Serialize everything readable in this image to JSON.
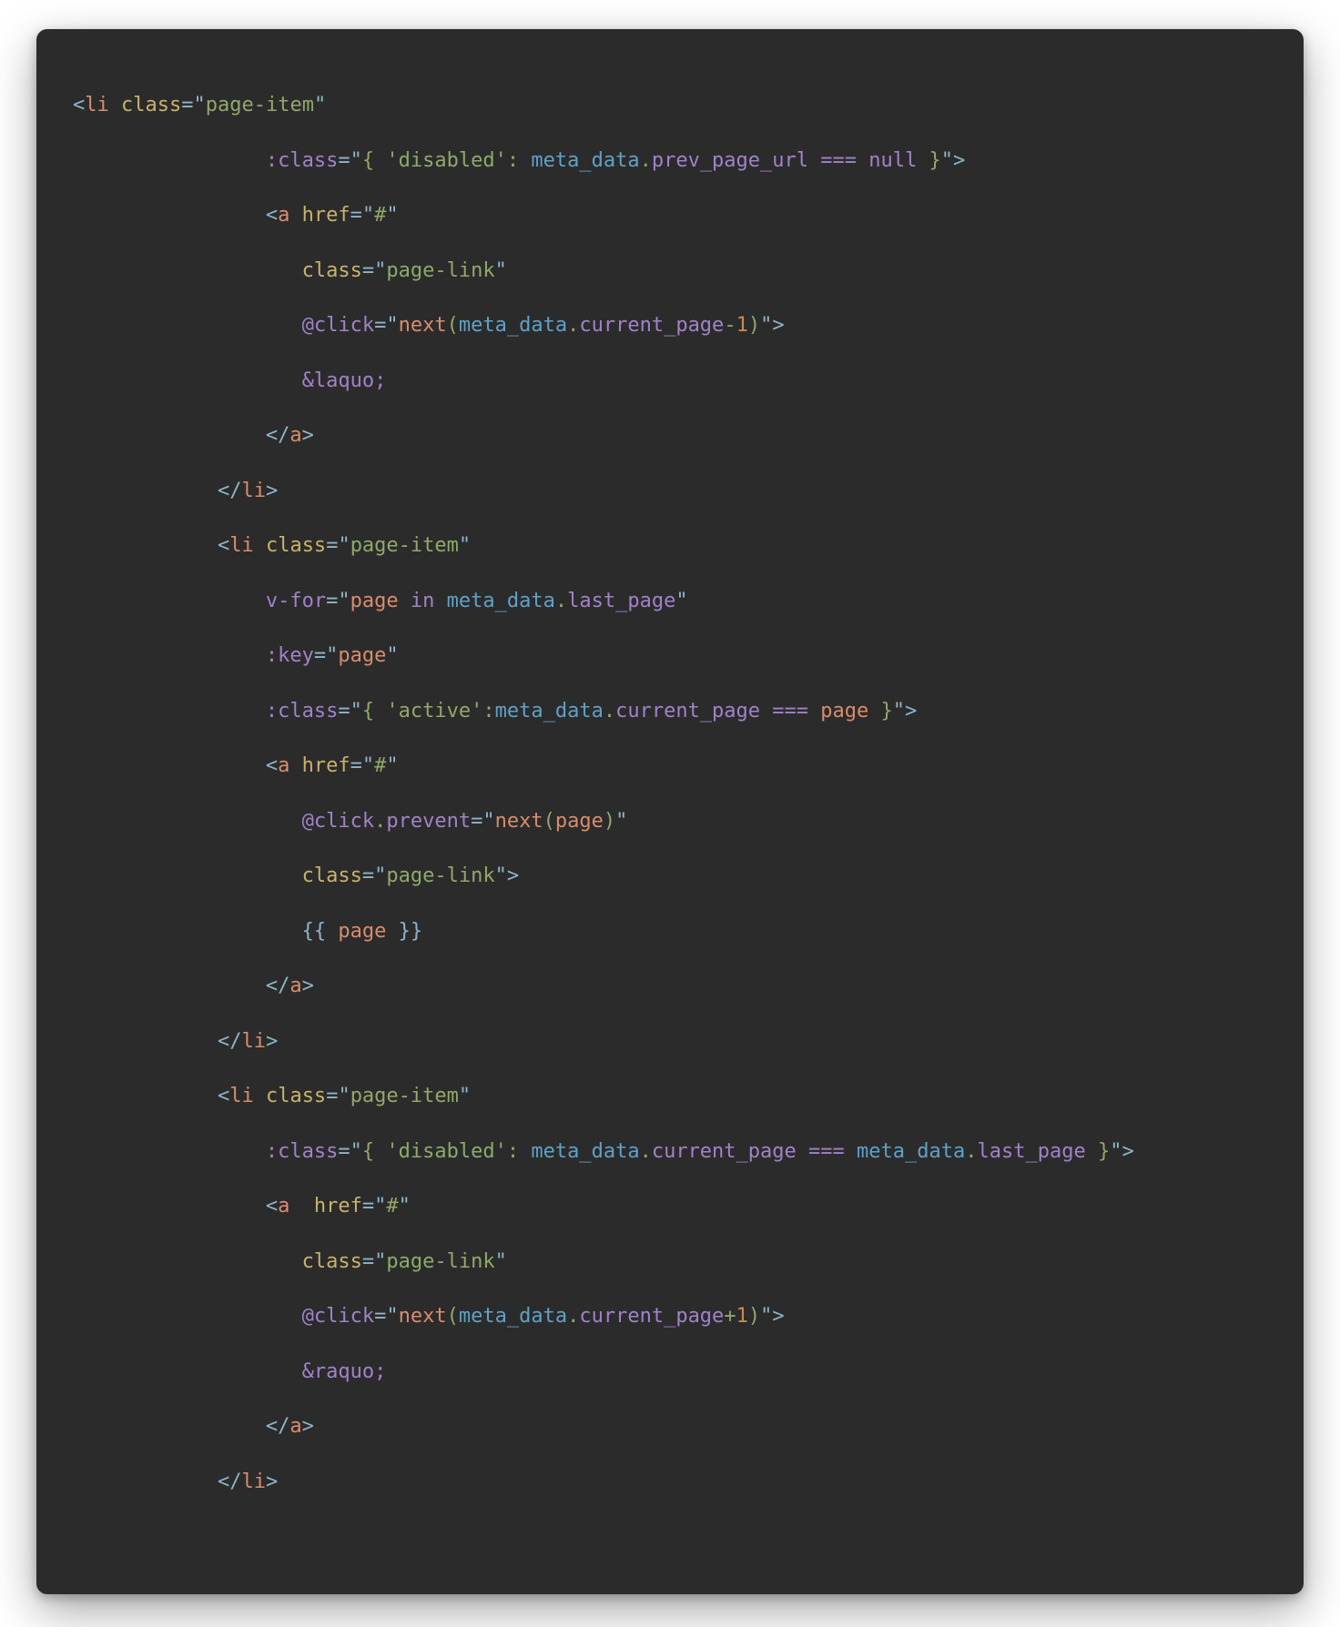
{
  "code": {
    "language": "vue-html",
    "raw": "<li class=\"page-item\"\n                :class=\"{ 'disabled': meta_data.prev_page_url === null }\">\n                <a href=\"#\"\n                   class=\"page-link\"\n                   @click=\"next(meta_data.current_page-1)\">\n                   &laquo;\n                </a>\n            </li>\n            <li class=\"page-item\"\n                v-for=\"page in meta_data.last_page\"\n                :key=\"page\"\n                :class=\"{ 'active':meta_data.current_page === page }\">\n                <a href=\"#\"\n                   @click.prevent=\"next(page)\"\n                   class=\"page-link\">\n                   {{ page }}\n                </a>\n            </li>\n            <li class=\"page-item\"\n                :class=\"{ 'disabled': meta_data.current_page === meta_data.last_page }\">\n                <a  href=\"#\"\n                   class=\"page-link\"\n                   @click=\"next(meta_data.current_page+1)\">\n                   &raquo;\n                </a>\n            </li>",
    "tokens": [
      [
        [
          "pun",
          "<"
        ],
        [
          "tag",
          "li"
        ],
        [
          "",
          " "
        ],
        [
          "attr",
          "class"
        ],
        [
          "pun",
          "="
        ],
        [
          "pun",
          "\""
        ],
        [
          "str",
          "page-item"
        ],
        [
          "pun",
          "\""
        ]
      ],
      [
        [
          "",
          "                "
        ],
        [
          "dir",
          ":class"
        ],
        [
          "pun",
          "="
        ],
        [
          "pun",
          "\""
        ],
        [
          "str",
          "{ "
        ],
        [
          "str",
          "'disabled'"
        ],
        [
          "str",
          ": "
        ],
        [
          "obj",
          "meta_data"
        ],
        [
          "str",
          "."
        ],
        [
          "prop",
          "prev_page_url"
        ],
        [
          "",
          " "
        ],
        [
          "kw",
          "==="
        ],
        [
          "",
          " "
        ],
        [
          "kw",
          "null"
        ],
        [
          "str",
          " }"
        ],
        [
          "pun",
          "\""
        ],
        [
          "pun",
          ">"
        ]
      ],
      [
        [
          "",
          "                "
        ],
        [
          "pun",
          "<"
        ],
        [
          "tag",
          "a"
        ],
        [
          "",
          " "
        ],
        [
          "attr",
          "href"
        ],
        [
          "pun",
          "="
        ],
        [
          "pun",
          "\""
        ],
        [
          "str",
          "#"
        ],
        [
          "pun",
          "\""
        ]
      ],
      [
        [
          "",
          "                   "
        ],
        [
          "attr",
          "class"
        ],
        [
          "pun",
          "="
        ],
        [
          "pun",
          "\""
        ],
        [
          "str",
          "page-link"
        ],
        [
          "pun",
          "\""
        ]
      ],
      [
        [
          "",
          "                   "
        ],
        [
          "dir",
          "@click"
        ],
        [
          "pun",
          "="
        ],
        [
          "pun",
          "\""
        ],
        [
          "fn",
          "next"
        ],
        [
          "str",
          "("
        ],
        [
          "obj",
          "meta_data"
        ],
        [
          "str",
          "."
        ],
        [
          "prop",
          "current_page"
        ],
        [
          "str",
          "-"
        ],
        [
          "num",
          "1"
        ],
        [
          "str",
          ")"
        ],
        [
          "pun",
          "\""
        ],
        [
          "pun",
          ">"
        ]
      ],
      [
        [
          "",
          "                   "
        ],
        [
          "ent",
          "&laquo;"
        ]
      ],
      [
        [
          "",
          "                "
        ],
        [
          "pun",
          "</"
        ],
        [
          "tag",
          "a"
        ],
        [
          "pun",
          ">"
        ]
      ],
      [
        [
          "",
          "            "
        ],
        [
          "pun",
          "</"
        ],
        [
          "tag",
          "li"
        ],
        [
          "pun",
          ">"
        ]
      ],
      [
        [
          "",
          "            "
        ],
        [
          "pun",
          "<"
        ],
        [
          "tag",
          "li"
        ],
        [
          "",
          " "
        ],
        [
          "attr",
          "class"
        ],
        [
          "pun",
          "="
        ],
        [
          "pun",
          "\""
        ],
        [
          "str",
          "page-item"
        ],
        [
          "pun",
          "\""
        ]
      ],
      [
        [
          "",
          "                "
        ],
        [
          "dir",
          "v-for"
        ],
        [
          "pun",
          "="
        ],
        [
          "pun",
          "\""
        ],
        [
          "var",
          "page"
        ],
        [
          "",
          " "
        ],
        [
          "kw",
          "in"
        ],
        [
          "",
          " "
        ],
        [
          "obj",
          "meta_data"
        ],
        [
          "str",
          "."
        ],
        [
          "prop",
          "last_page"
        ],
        [
          "pun",
          "\""
        ]
      ],
      [
        [
          "",
          "                "
        ],
        [
          "dir",
          ":key"
        ],
        [
          "pun",
          "="
        ],
        [
          "pun",
          "\""
        ],
        [
          "var",
          "page"
        ],
        [
          "pun",
          "\""
        ]
      ],
      [
        [
          "",
          "                "
        ],
        [
          "dir",
          ":class"
        ],
        [
          "pun",
          "="
        ],
        [
          "pun",
          "\""
        ],
        [
          "str",
          "{ "
        ],
        [
          "str",
          "'active'"
        ],
        [
          "str",
          ":"
        ],
        [
          "obj",
          "meta_data"
        ],
        [
          "str",
          "."
        ],
        [
          "prop",
          "current_page"
        ],
        [
          "",
          " "
        ],
        [
          "kw",
          "==="
        ],
        [
          "",
          " "
        ],
        [
          "var",
          "page"
        ],
        [
          "str",
          " }"
        ],
        [
          "pun",
          "\""
        ],
        [
          "pun",
          ">"
        ]
      ],
      [
        [
          "",
          "                "
        ],
        [
          "pun",
          "<"
        ],
        [
          "tag",
          "a"
        ],
        [
          "",
          " "
        ],
        [
          "attr",
          "href"
        ],
        [
          "pun",
          "="
        ],
        [
          "pun",
          "\""
        ],
        [
          "str",
          "#"
        ],
        [
          "pun",
          "\""
        ]
      ],
      [
        [
          "",
          "                   "
        ],
        [
          "dir",
          "@click"
        ],
        [
          "str",
          "."
        ],
        [
          "prop",
          "prevent"
        ],
        [
          "pun",
          "="
        ],
        [
          "pun",
          "\""
        ],
        [
          "fn",
          "next"
        ],
        [
          "str",
          "("
        ],
        [
          "var",
          "page"
        ],
        [
          "str",
          ")"
        ],
        [
          "pun",
          "\""
        ]
      ],
      [
        [
          "",
          "                   "
        ],
        [
          "attr",
          "class"
        ],
        [
          "pun",
          "="
        ],
        [
          "pun",
          "\""
        ],
        [
          "str",
          "page-link"
        ],
        [
          "pun",
          "\""
        ],
        [
          "pun",
          ">"
        ]
      ],
      [
        [
          "",
          "                   "
        ],
        [
          "expr",
          "{{ "
        ],
        [
          "var",
          "page"
        ],
        [
          "expr",
          " }}"
        ]
      ],
      [
        [
          "",
          "                "
        ],
        [
          "pun",
          "</"
        ],
        [
          "tag",
          "a"
        ],
        [
          "pun",
          ">"
        ]
      ],
      [
        [
          "",
          "            "
        ],
        [
          "pun",
          "</"
        ],
        [
          "tag",
          "li"
        ],
        [
          "pun",
          ">"
        ]
      ],
      [
        [
          "",
          "            "
        ],
        [
          "pun",
          "<"
        ],
        [
          "tag",
          "li"
        ],
        [
          "",
          " "
        ],
        [
          "attr",
          "class"
        ],
        [
          "pun",
          "="
        ],
        [
          "pun",
          "\""
        ],
        [
          "str",
          "page-item"
        ],
        [
          "pun",
          "\""
        ]
      ],
      [
        [
          "",
          "                "
        ],
        [
          "dir",
          ":class"
        ],
        [
          "pun",
          "="
        ],
        [
          "pun",
          "\""
        ],
        [
          "str",
          "{ "
        ],
        [
          "str",
          "'disabled'"
        ],
        [
          "str",
          ": "
        ],
        [
          "obj",
          "meta_data"
        ],
        [
          "str",
          "."
        ],
        [
          "prop",
          "current_page"
        ],
        [
          "",
          " "
        ],
        [
          "kw",
          "==="
        ],
        [
          "",
          " "
        ],
        [
          "obj",
          "meta_data"
        ],
        [
          "str",
          "."
        ],
        [
          "prop",
          "last_page"
        ],
        [
          "str",
          " }"
        ],
        [
          "pun",
          "\""
        ],
        [
          "pun",
          ">"
        ]
      ],
      [
        [
          "",
          "                "
        ],
        [
          "pun",
          "<"
        ],
        [
          "tag",
          "a"
        ],
        [
          "",
          "  "
        ],
        [
          "attr",
          "href"
        ],
        [
          "pun",
          "="
        ],
        [
          "pun",
          "\""
        ],
        [
          "str",
          "#"
        ],
        [
          "pun",
          "\""
        ]
      ],
      [
        [
          "",
          "                   "
        ],
        [
          "attr",
          "class"
        ],
        [
          "pun",
          "="
        ],
        [
          "pun",
          "\""
        ],
        [
          "str",
          "page-link"
        ],
        [
          "pun",
          "\""
        ]
      ],
      [
        [
          "",
          "                   "
        ],
        [
          "dir",
          "@click"
        ],
        [
          "pun",
          "="
        ],
        [
          "pun",
          "\""
        ],
        [
          "fn",
          "next"
        ],
        [
          "str",
          "("
        ],
        [
          "obj",
          "meta_data"
        ],
        [
          "str",
          "."
        ],
        [
          "prop",
          "current_page"
        ],
        [
          "str",
          "+"
        ],
        [
          "num",
          "1"
        ],
        [
          "str",
          ")"
        ],
        [
          "pun",
          "\""
        ],
        [
          "pun",
          ">"
        ]
      ],
      [
        [
          "",
          "                   "
        ],
        [
          "ent",
          "&raquo;"
        ]
      ],
      [
        [
          "",
          "                "
        ],
        [
          "pun",
          "</"
        ],
        [
          "tag",
          "a"
        ],
        [
          "pun",
          ">"
        ]
      ],
      [
        [
          "",
          "            "
        ],
        [
          "pun",
          "</"
        ],
        [
          "tag",
          "li"
        ],
        [
          "pun",
          ">"
        ]
      ]
    ]
  }
}
